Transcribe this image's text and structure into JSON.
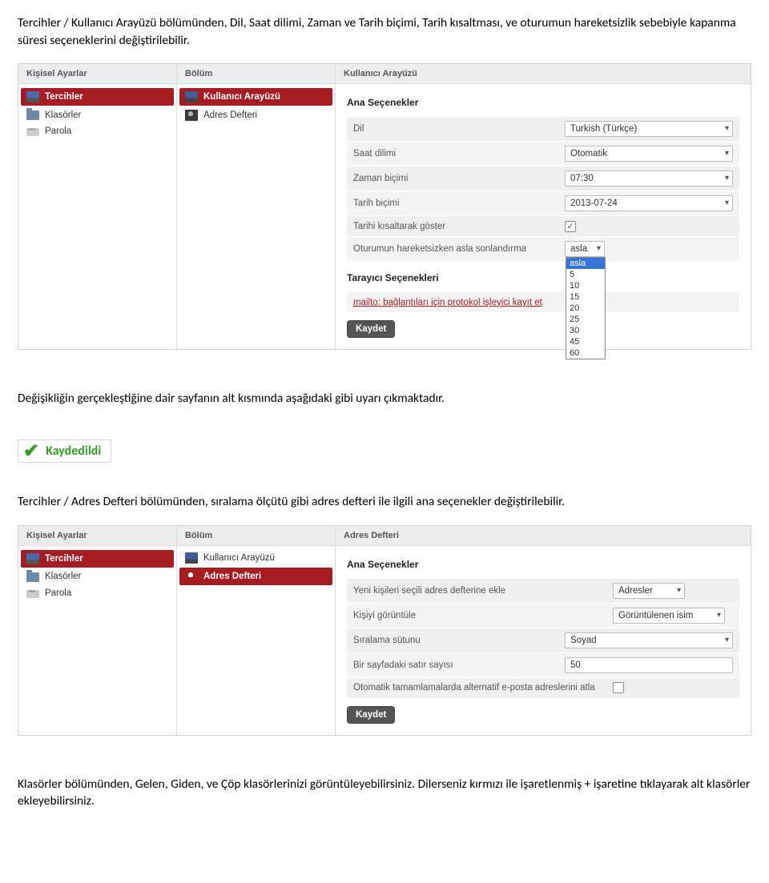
{
  "para1": "Tercihler / Kullanıcı Arayüzü bölümünden, Dil, Saat dilimi, Zaman ve Tarih biçimi, Tarih kısaltması, ve oturumun hareketsizlik sebebiyle kapanma süresi seçeneklerini değiştirilebilir.",
  "para2": "Değişikliğin gerçekleştiğine dair sayfanın alt kısmında aşağıdaki gibi uyarı çıkmaktadır.",
  "para3": "Tercihler / Adres Defteri bölümünden, sıralama ölçütü gibi adres defteri ile ilgili ana seçenekler değiştirilebilir.",
  "para4": "Klasörler bölümünden, Gelen, Giden, ve Çöp klasörlerinizi görüntüleyebilirsiniz. Dilerseniz kırmızı ile işaretlenmiş  + işaretine tıklayarak alt klasörler ekleyebilirsiniz.",
  "saved_text": "Kaydedildi",
  "panel1": {
    "col1": {
      "title": "Kişisel Ayarlar",
      "items": [
        {
          "label": "Tercihler",
          "selected": true,
          "icon": "screen"
        },
        {
          "label": "Klasörler",
          "selected": false,
          "icon": "folder"
        },
        {
          "label": "Parola",
          "selected": false,
          "icon": "key"
        }
      ]
    },
    "col2": {
      "title": "Bölüm",
      "items": [
        {
          "label": "Kullanıcı Arayüzü",
          "selected": true,
          "icon": "screen-small"
        },
        {
          "label": "Adres Defteri",
          "selected": false,
          "icon": "person-dark"
        }
      ]
    },
    "col3": {
      "title": "Kullanıcı Arayüzü",
      "section1_title": "Ana Seçenekler",
      "rows": [
        {
          "label": "Dil",
          "value": "Turkish (Türkçe)",
          "type": "select"
        },
        {
          "label": "Saat dilimi",
          "value": "Otomatik",
          "type": "select"
        },
        {
          "label": "Zaman biçimi",
          "value": "07:30",
          "type": "select"
        },
        {
          "label": "Tarih biçimi",
          "value": "2013-07-24",
          "type": "select"
        },
        {
          "label": "Tarihi kısaltarak göster",
          "value": "checked",
          "type": "checkbox"
        },
        {
          "label": "Oturumun hareketsizken asla sonlandırma",
          "value": "asla",
          "type": "dropdown-open",
          "options": [
            "asla",
            "5",
            "10",
            "15",
            "20",
            "25",
            "30",
            "45",
            "60"
          ]
        }
      ],
      "section2_title": "Tarayıcı Seçenekleri",
      "link_text": "mailto: bağlantıları için protokol işleyici kayıt et",
      "save_button": "Kaydet"
    }
  },
  "panel2": {
    "col1": {
      "title": "Kişisel Ayarlar",
      "items": [
        {
          "label": "Tercihler",
          "selected": true,
          "icon": "screen"
        },
        {
          "label": "Klasörler",
          "selected": false,
          "icon": "folder"
        },
        {
          "label": "Parola",
          "selected": false,
          "icon": "key"
        }
      ]
    },
    "col2": {
      "title": "Bölüm",
      "items": [
        {
          "label": "Kullanıcı Arayüzü",
          "selected": false,
          "icon": "screen-small"
        },
        {
          "label": "Adres Defteri",
          "selected": true,
          "icon": "person"
        }
      ]
    },
    "col3": {
      "title": "Adres Defteri",
      "section1_title": "Ana Seçenekler",
      "rows": [
        {
          "label": "Yeni kişileri seçili adres defterine ekle",
          "value": "Adresler",
          "type": "select-narrow"
        },
        {
          "label": "Kişiyi görüntüle",
          "value": "Görüntülenen isim",
          "type": "select-narrow"
        },
        {
          "label": "Sıralama sütunu",
          "value": "Soyad",
          "type": "select"
        },
        {
          "label": "Bir sayfadaki satır sayısı",
          "value": "50",
          "type": "input"
        },
        {
          "label": "Otomatik tamamlamalarda alternatif e-posta adreslerini atla",
          "value": "",
          "type": "checkbox"
        }
      ],
      "save_button": "Kaydet"
    }
  }
}
